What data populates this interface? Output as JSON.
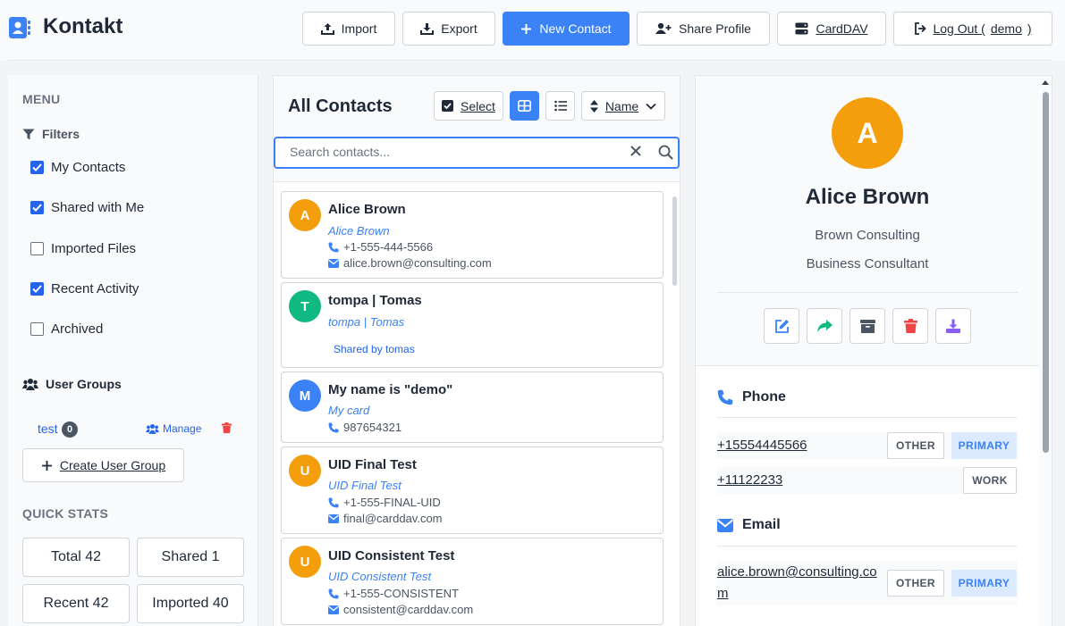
{
  "app": {
    "title": "Kontakt"
  },
  "header": {
    "import_label": "Import",
    "export_label": "Export",
    "new_contact_label": "New Contact",
    "share_profile_label": "Share Profile",
    "carddav_label": "CardDAV",
    "logout_prefix": "Log Out (",
    "logout_user": "demo",
    "logout_suffix": ")"
  },
  "sidebar": {
    "menu_title": "MENU",
    "filters_title": "Filters",
    "filters": [
      {
        "label": "My Contacts",
        "checked": true
      },
      {
        "label": "Shared with Me",
        "checked": true
      },
      {
        "label": "Imported Files",
        "checked": false
      },
      {
        "label": "Recent Activity",
        "checked": true
      },
      {
        "label": "Archived",
        "checked": false
      }
    ],
    "groups_title": "User Groups",
    "groups": [
      {
        "name": "test",
        "count": "0",
        "manage_label": "Manage"
      }
    ],
    "create_group_label": "Create User Group",
    "stats_title": "QUICK STATS",
    "stats": [
      "Total 42",
      "Shared 1",
      "Recent 42",
      "Imported 40"
    ]
  },
  "contacts_panel": {
    "title": "All Contacts",
    "select_label": "Select",
    "sort_label": "Name",
    "search_placeholder": "Search contacts...",
    "contacts": [
      {
        "initial": "A",
        "name": "Alice Brown",
        "nickname": "Alice Brown",
        "phone": "+1-555-444-5566",
        "email": "alice.brown@consulting.com",
        "color": "#f59e0b"
      },
      {
        "initial": "T",
        "name": "tompa | Tomas",
        "nickname": "tompa | Tomas",
        "shared_by": "Shared by tomas",
        "color": "#10b981"
      },
      {
        "initial": "M",
        "name": "My name is \"demo\"",
        "nickname": "My card",
        "phone": "987654321",
        "color": "#3b82f6"
      },
      {
        "initial": "U",
        "name": "UID Final Test",
        "nickname": "UID Final Test",
        "phone": "+1-555-FINAL-UID",
        "email": "final@carddav.com",
        "color": "#f59e0b"
      },
      {
        "initial": "U",
        "name": "UID Consistent Test",
        "nickname": "UID Consistent Test",
        "phone": "+1-555-CONSISTENT",
        "email": "consistent@carddav.com",
        "color": "#f59e0b"
      }
    ]
  },
  "detail": {
    "initial": "A",
    "name": "Alice Brown",
    "company": "Brown Consulting",
    "job_title": "Business Consultant",
    "phone_title": "Phone",
    "phones": [
      {
        "value": "+15554445566",
        "type": "OTHER",
        "primary": "PRIMARY"
      },
      {
        "value": "+11122233",
        "type": "WORK"
      }
    ],
    "email_title": "Email",
    "emails": [
      {
        "value_line1": "alice.brown@consulting.co",
        "value_line2": "m",
        "type": "OTHER",
        "primary": "PRIMARY"
      }
    ]
  },
  "colors": {
    "accent": "#3b82f6",
    "danger": "#ef4444",
    "success": "#10b981",
    "warning": "#f59e0b",
    "purple": "#8b5cf6"
  }
}
